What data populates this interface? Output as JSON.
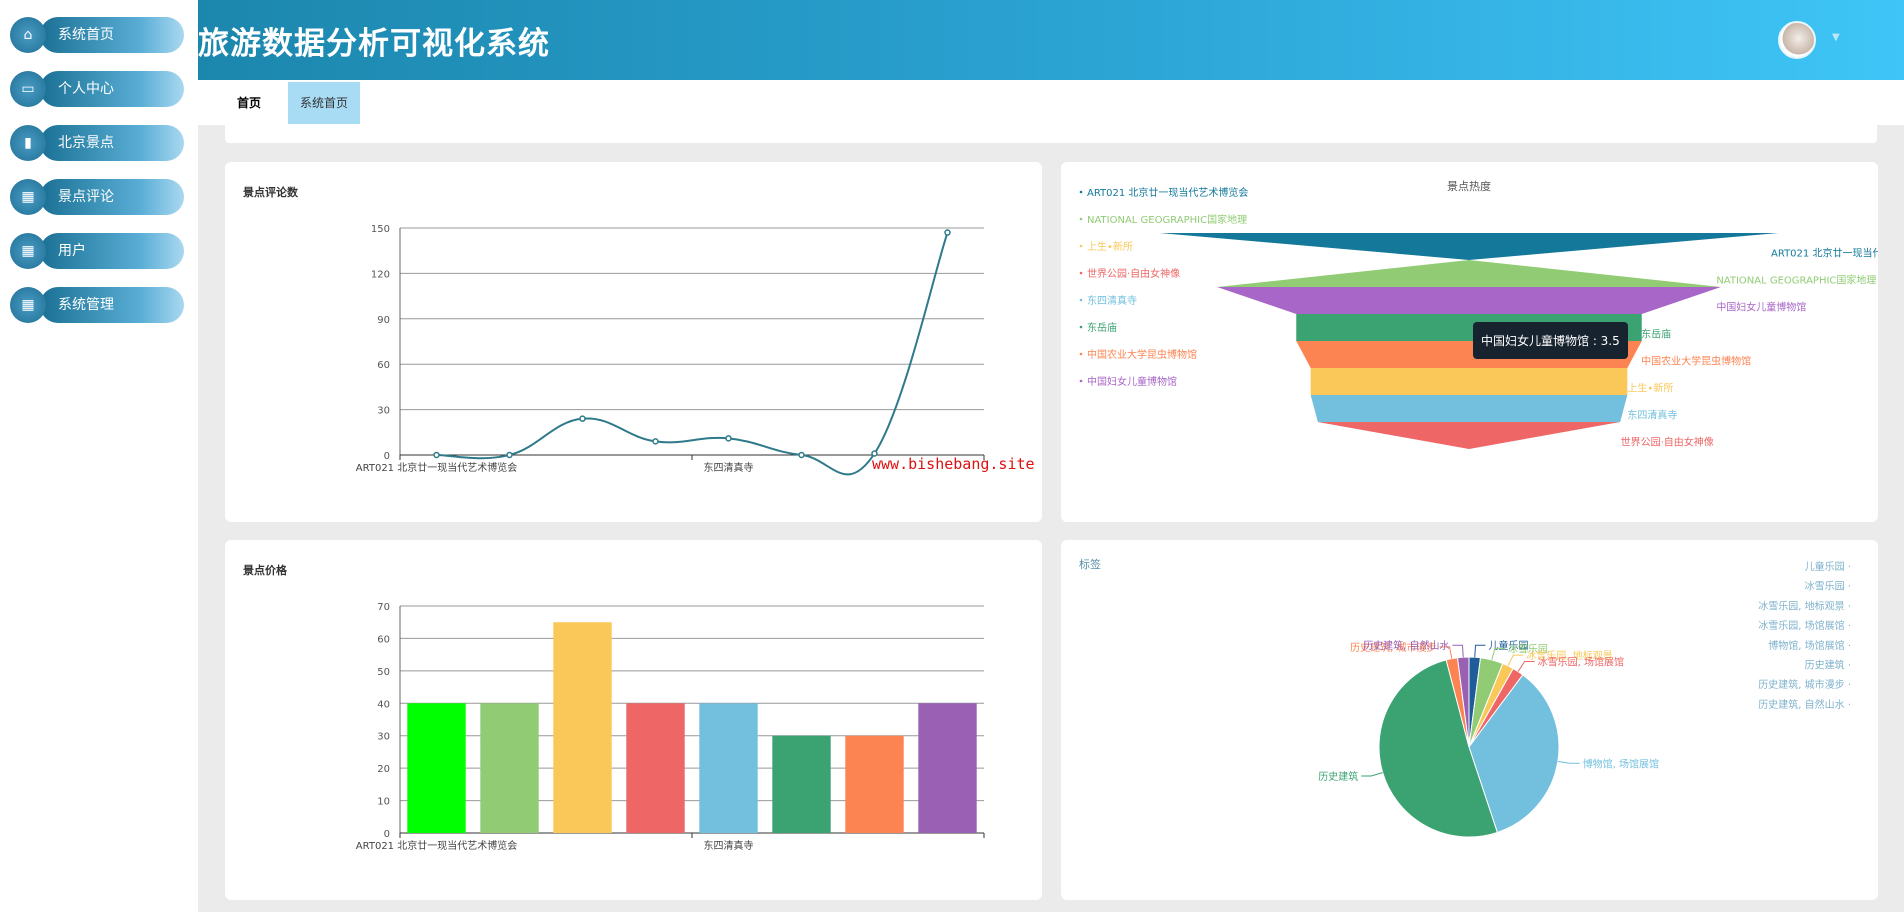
{
  "app": {
    "title": "旅游数据分析可视化系统",
    "avatar_icon": "user-avatar",
    "caret_icon": "caret-down-icon"
  },
  "sidebar": {
    "items": [
      {
        "label": "系统首页",
        "icon": "home-icon",
        "glyph": "⌂"
      },
      {
        "label": "个人中心",
        "icon": "profile-icon",
        "glyph": "▭"
      },
      {
        "label": "北京景点",
        "icon": "clipboard-icon",
        "glyph": "▮"
      },
      {
        "label": "景点评论",
        "icon": "grid-icon",
        "glyph": "▦"
      },
      {
        "label": "用户",
        "icon": "grid-icon",
        "glyph": "▦"
      },
      {
        "label": "系统管理",
        "icon": "grid-icon",
        "glyph": "▦"
      }
    ]
  },
  "tabs": [
    {
      "label": "首页",
      "active": false
    },
    {
      "label": "系统首页",
      "active": true
    }
  ],
  "watermark": "www.bishebang.site",
  "colors": {
    "accent": "#1c87ad",
    "tab_active": "#a8dcf5",
    "line": "#2e7a8a"
  },
  "chart_data": [
    {
      "type": "line",
      "title": "景点评论数",
      "smooth": true,
      "categories": [
        "ART021 北京廿一现当代艺术博览会",
        "NATIONAL GEOGRAPHIC国家地理",
        "上生•新所",
        "世界公园·自由女神像",
        "东四清真寺",
        "东岳庙",
        "中国农业大学昆虫博物馆",
        "中国妇女儿童博物馆"
      ],
      "shown_tick_labels": [
        "ART021 北京廿一现当代艺术博览会",
        "东四清真寺"
      ],
      "values": [
        0,
        0,
        24,
        9,
        11,
        0,
        1,
        147
      ],
      "ylim": [
        0,
        150
      ],
      "yticks": [
        0,
        30,
        60,
        90,
        120,
        150
      ],
      "grid": true,
      "color": "#2e7a8a"
    },
    {
      "type": "funnel",
      "title": "景点热度",
      "legend_position": "top-left",
      "series": [
        {
          "name": "ART021 北京廿一现当代艺术博览会",
          "value": 4.3,
          "color": "#13789a"
        },
        {
          "name": "NATIONAL GEOGRAPHIC国家地理",
          "value": 0,
          "color": "#91cc75"
        },
        {
          "name": "中国妇女儿童博物馆",
          "value": 3.5,
          "color": "#a866c8"
        },
        {
          "name": "东岳庙",
          "value": 2.4,
          "color": "#3ba272"
        },
        {
          "name": "中国农业大学昆虫博物馆",
          "value": 2.4,
          "color": "#fc8452"
        },
        {
          "name": "上生•新所",
          "value": 2.2,
          "color": "#fac858"
        },
        {
          "name": "东四清真寺",
          "value": 2.2,
          "color": "#73c0de"
        },
        {
          "name": "世界公园·自由女神像",
          "value": 2.1,
          "color": "#ee6666"
        }
      ],
      "legend": [
        "ART021 北京廿一现当代艺术博览会",
        "NATIONAL GEOGRAPHIC国家地理",
        "上生•新所",
        "世界公园·自由女神像",
        "东四清真寺",
        "东岳庙",
        "中国农业大学昆虫博物馆",
        "中国妇女儿童博物馆"
      ],
      "tooltip": "中国妇女儿童博物馆 : 3.5"
    },
    {
      "type": "bar",
      "title": "景点价格",
      "categories": [
        "ART021 北京廿一现当代艺术博览会",
        "NATIONAL GEOGRAPHIC国家地理",
        "上生•新所",
        "世界公园·自由女神像",
        "东四清真寺",
        "东岳庙",
        "中国农业大学昆虫博物馆",
        "中国妇女儿童博物馆"
      ],
      "shown_tick_labels": [
        "ART021 北京廿一现当代艺术博览会",
        "东四清真寺"
      ],
      "values": [
        40,
        40,
        65,
        40,
        40,
        30,
        30,
        40
      ],
      "ylim": [
        0,
        70
      ],
      "yticks": [
        0,
        10,
        20,
        30,
        40,
        50,
        60,
        70
      ],
      "grid": true,
      "colors": [
        "#00ff00",
        "#91cc75",
        "#fac858",
        "#ee6666",
        "#73c0de",
        "#3ba272",
        "#fc8452",
        "#9a60b4"
      ]
    },
    {
      "type": "pie",
      "title": "标签",
      "legend_position": "top-right",
      "series": [
        {
          "name": "儿童乐园",
          "value": 1,
          "color": "#1f5d9a"
        },
        {
          "name": "冰雪乐园",
          "value": 2,
          "color": "#91cc75"
        },
        {
          "name": "冰雪乐园, 地标观景",
          "value": 1,
          "color": "#fac858"
        },
        {
          "name": "冰雪乐园, 场馆展馆",
          "value": 1,
          "color": "#ee6666"
        },
        {
          "name": "博物馆, 场馆展馆",
          "value": 17,
          "color": "#73c0de"
        },
        {
          "name": "历史建筑",
          "value": 25,
          "color": "#3ba272"
        },
        {
          "name": "历史建筑, 城市漫步",
          "value": 1,
          "color": "#fc8452"
        },
        {
          "name": "历史建筑, 自然山水",
          "value": 1,
          "color": "#9a60b4"
        }
      ]
    }
  ]
}
